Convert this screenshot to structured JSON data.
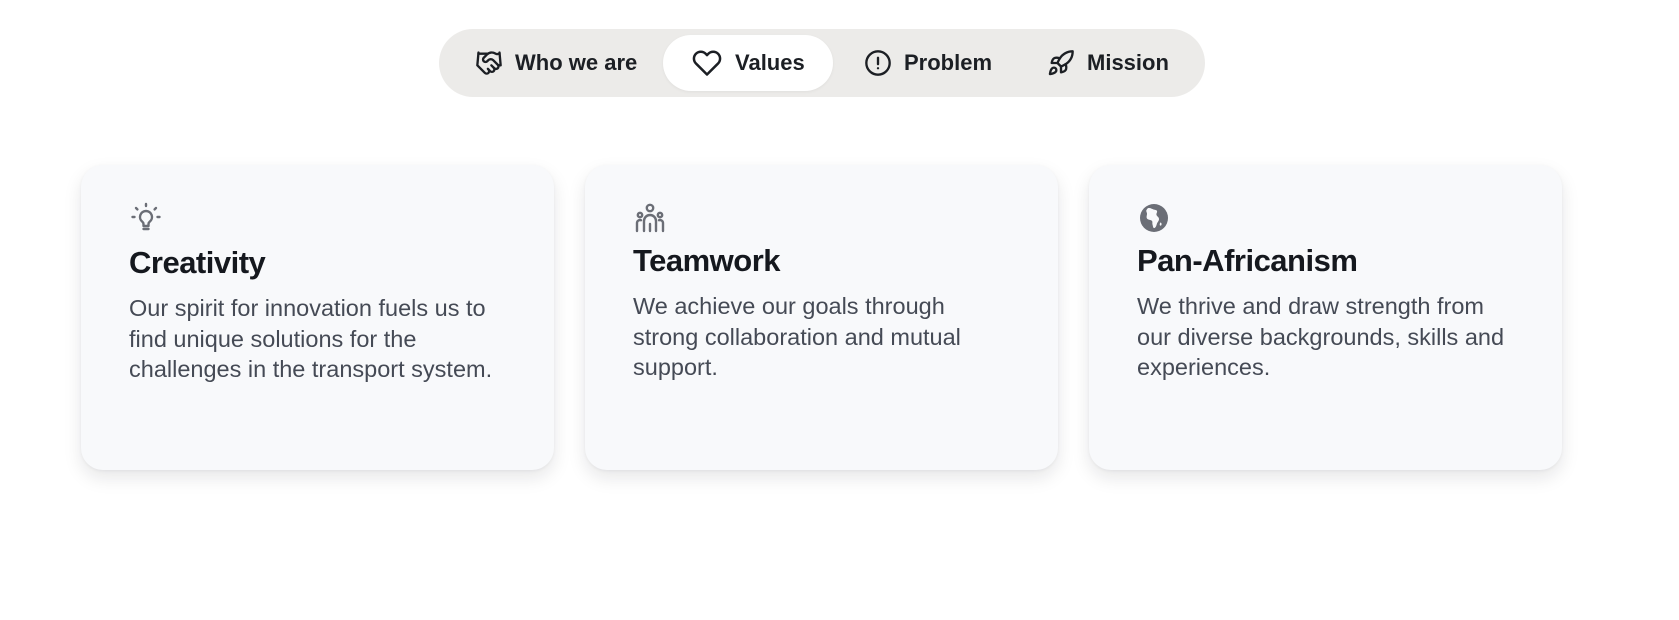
{
  "tabs": [
    {
      "label": "Who we are",
      "icon": "handshake-icon",
      "active": false
    },
    {
      "label": "Values",
      "icon": "heart-icon",
      "active": true
    },
    {
      "label": "Problem",
      "icon": "alert-circle-icon",
      "active": false
    },
    {
      "label": "Mission",
      "icon": "rocket-icon",
      "active": false
    }
  ],
  "cards": [
    {
      "icon": "lightbulb-icon",
      "title": "Creativity",
      "description": "Our spirit for innovation fuels us to find unique solutions for the challenges in the transport system."
    },
    {
      "icon": "team-icon",
      "title": "Teamwork",
      "description": "We achieve our goals through strong collaboration and mutual support."
    },
    {
      "icon": "globe-africa-icon",
      "title": "Pan-Africanism",
      "description": "We thrive and draw strength from our diverse backgrounds, skills and experiences."
    }
  ],
  "colors": {
    "tab_bar_bg": "#ecebe9",
    "active_tab_bg": "#ffffff",
    "card_bg": "#f8f9fb",
    "title_text": "#15181e",
    "body_text": "#454a55",
    "icon_gray": "#6b6e76"
  }
}
